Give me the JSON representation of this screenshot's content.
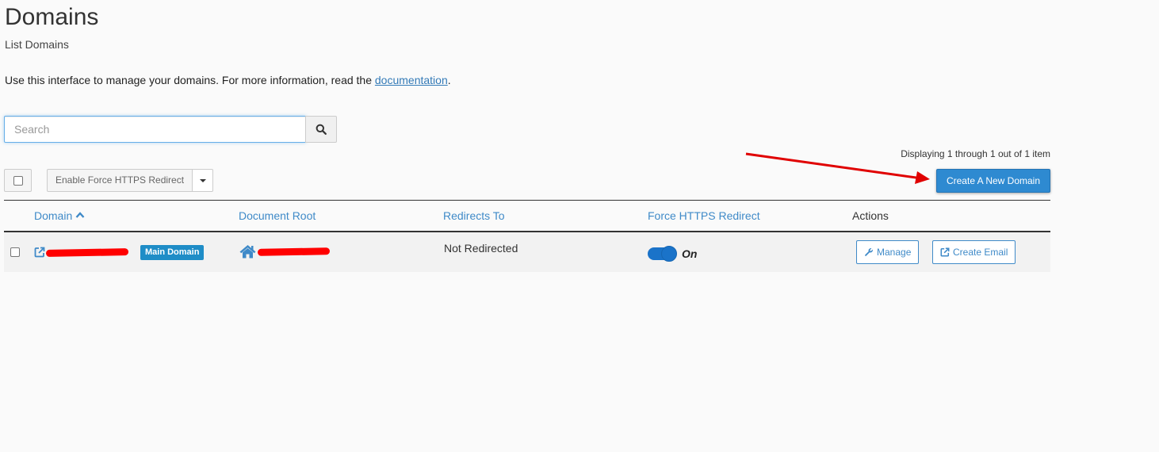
{
  "header": {
    "title": "Domains",
    "subtitle": "List Domains",
    "intro_text": "Use this interface to manage your domains. For more information, read the ",
    "intro_link": "documentation",
    "intro_suffix": "."
  },
  "search": {
    "placeholder": "Search",
    "value": ""
  },
  "toolbar": {
    "count_text": "Displaying 1 through 1 out of 1 item",
    "https_button_label": "Enable Force HTTPS Redirect",
    "create_button_label": "Create A New Domain"
  },
  "table": {
    "columns": [
      "Domain",
      "Document Root",
      "Redirects To",
      "Force HTTPS Redirect",
      "Actions"
    ],
    "sort_column": "Domain",
    "sort_direction": "ascending",
    "rows": [
      {
        "domain": "",
        "badge": "Main Domain",
        "document_root": "",
        "redirects_to": "Not Redirected",
        "force_https_state": "On",
        "force_https_enabled": true,
        "actions": [
          "Manage",
          "Create Email"
        ]
      }
    ]
  },
  "colors": {
    "link_blue": "#3f8ac8",
    "primary_button": "#2e8ad1",
    "badge": "#1f8dc7",
    "toggle_on": "#1a73c9",
    "annotation_arrow": "#e00000",
    "redaction": "#ff0000"
  },
  "icons": {
    "search": "search-icon",
    "sort": "chevron-up-icon",
    "domain_link": "external-link-icon",
    "document_root": "home-icon",
    "manage": "wrench-icon",
    "create_email": "external-link-icon"
  }
}
